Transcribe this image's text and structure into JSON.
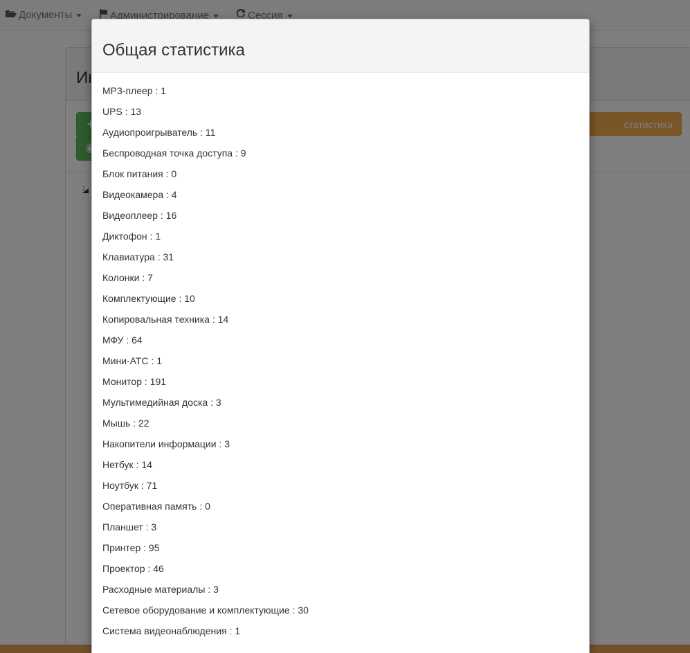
{
  "navbar": {
    "items": [
      {
        "label": "Документы"
      },
      {
        "label": "Администрирование"
      },
      {
        "label": "Сессия"
      }
    ]
  },
  "background_page": {
    "title_fragment": "Ин",
    "plus_glyph": "+",
    "eye_glyph": "◉",
    "orange_button_fragment": "статистика"
  },
  "modal": {
    "title": "Общая статистика",
    "separator": " : ",
    "stats": [
      {
        "name": "MP3-плеер",
        "count": "1"
      },
      {
        "name": "UPS",
        "count": "13"
      },
      {
        "name": "Аудиопроигрыватель",
        "count": "11"
      },
      {
        "name": "Беспроводная точка доступа",
        "count": "9"
      },
      {
        "name": "Блок питания",
        "count": "0"
      },
      {
        "name": "Видеокамера",
        "count": "4"
      },
      {
        "name": "Видеоплеер",
        "count": "16"
      },
      {
        "name": "Диктофон",
        "count": "1"
      },
      {
        "name": "Клавиатура",
        "count": "31"
      },
      {
        "name": "Колонки",
        "count": "7"
      },
      {
        "name": "Комплектующие",
        "count": "10"
      },
      {
        "name": "Копировальная техника",
        "count": "14"
      },
      {
        "name": "МФУ",
        "count": "64"
      },
      {
        "name": "Мини-АТС",
        "count": "1"
      },
      {
        "name": "Монитор",
        "count": "191"
      },
      {
        "name": "Мультимедийная доска",
        "count": "3"
      },
      {
        "name": "Мышь",
        "count": "22"
      },
      {
        "name": "Накопители информации",
        "count": "3"
      },
      {
        "name": "Нетбук",
        "count": "14"
      },
      {
        "name": "Ноутбук",
        "count": "71"
      },
      {
        "name": "Оперативная память",
        "count": "0"
      },
      {
        "name": "Планшет",
        "count": "3"
      },
      {
        "name": "Принтер",
        "count": "95"
      },
      {
        "name": "Проектор",
        "count": "46"
      },
      {
        "name": "Расходные материалы",
        "count": "3"
      },
      {
        "name": "Сетевое оборудование и комплектующие",
        "count": "30"
      },
      {
        "name": "Система видеонаблюдения",
        "count": "1"
      }
    ]
  },
  "colors": {
    "success": "#5cb85c",
    "warning": "#f0ad4e",
    "backdrop": "rgba(0,0,0,0.5)"
  }
}
